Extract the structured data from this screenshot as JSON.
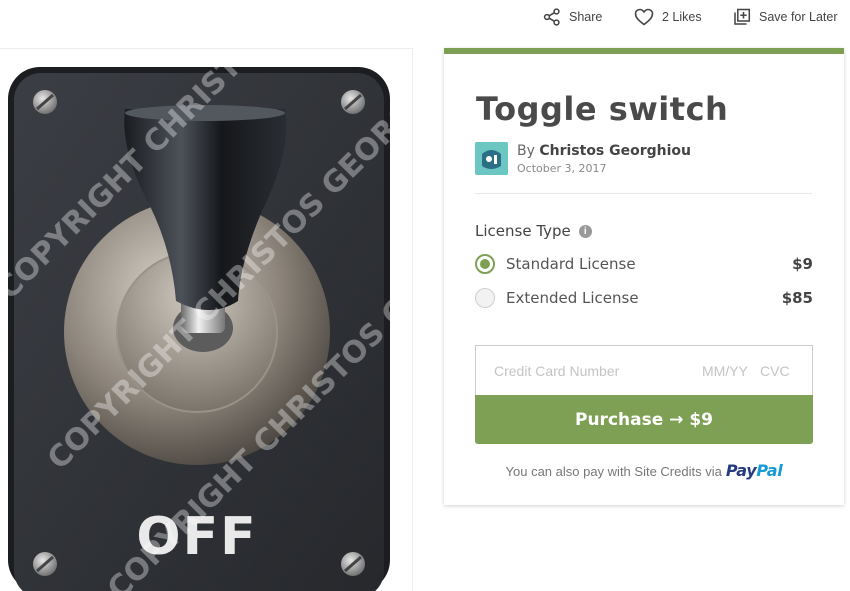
{
  "actions": {
    "share_label": "Share",
    "likes_label": "2 Likes",
    "save_label": "Save for Later"
  },
  "image": {
    "switch_text": "OFF",
    "watermark_text": "COPYRIGHT CHRISTOS GEORGHIOU"
  },
  "product": {
    "title": "Toggle switch",
    "author_prefix": "By",
    "author_name": "Christos Georghiou",
    "date": "October 3, 2017"
  },
  "license": {
    "heading": "License Type",
    "info_icon": "i",
    "options": [
      {
        "label": "Standard License",
        "price": "$9",
        "selected": true
      },
      {
        "label": "Extended License",
        "price": "$85",
        "selected": false
      }
    ]
  },
  "payment": {
    "card_number_placeholder": "Credit Card Number",
    "expiry_placeholder": "MM/YY",
    "cvc_placeholder": "CVC",
    "purchase_label": "Purchase → $9",
    "alt_text": "You can also pay with Site Credits via",
    "paypal_part1": "Pay",
    "paypal_part2": "Pal"
  },
  "colors": {
    "accent": "#7ea054",
    "paypal_dark": "#253b80",
    "paypal_light": "#179bd7"
  }
}
